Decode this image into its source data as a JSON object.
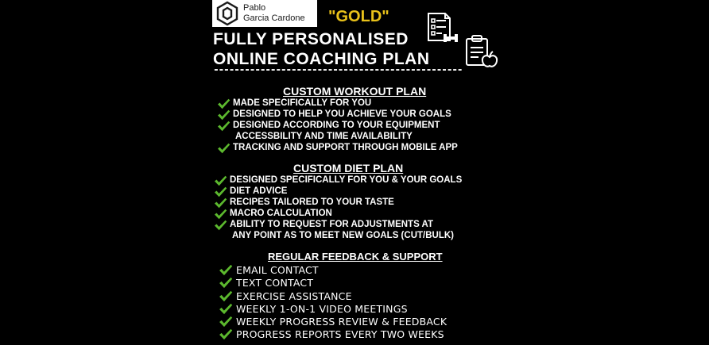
{
  "brand": {
    "logo_line1": "Pablo",
    "logo_line2": "Garcia Cardone",
    "badge": "\"GOLD\""
  },
  "header": {
    "title_line1": "FULLY PERSONALISED",
    "title_line2": "ONLINE COACHING PLAN",
    "divider": "------------------------------------------------",
    "icons": [
      "checklist-dumbbell-icon",
      "clipboard-apple-icon"
    ]
  },
  "workout": {
    "title": "CUSTOM WORKOUT PLAN",
    "items": [
      {
        "lines": [
          "MADE SPECIFICALLY FOR YOU"
        ]
      },
      {
        "lines": [
          "DESIGNED TO HELP YOU ACHIEVE YOUR GOALS"
        ]
      },
      {
        "lines": [
          "DESIGNED ACCORDING TO YOUR EQUIPMENT",
          "ACCESSBILITY AND TIME AVAILABILITY"
        ]
      },
      {
        "lines": [
          "TRACKING AND SUPPORT THROUGH MOBILE APP"
        ]
      }
    ]
  },
  "diet": {
    "title": "CUSTOM DIET PLAN",
    "items": [
      {
        "lines": [
          "DESIGNED SPECIFICALLY FOR YOU & YOUR GOALS"
        ]
      },
      {
        "lines": [
          "DIET ADVICE"
        ]
      },
      {
        "lines": [
          "RECIPES TAILORED TO YOUR TASTE"
        ]
      },
      {
        "lines": [
          "MACRO CALCULATION"
        ]
      },
      {
        "lines": [
          "ABILITY TO REQUEST FOR ADJUSTMENTS AT",
          "ANY POINT AS TO MEET NEW GOALS (CUT/BULK)"
        ]
      }
    ]
  },
  "support": {
    "title": "REGULAR FEEDBACK & SUPPORT",
    "items": [
      {
        "lines": [
          "EMAIL CONTACT"
        ]
      },
      {
        "lines": [
          "TEXT CONTACT"
        ]
      },
      {
        "lines": [
          "EXERCISE ASSISTANCE"
        ]
      },
      {
        "lines": [
          "WEEKLY 1-ON-1 VIDEO MEETINGS"
        ]
      },
      {
        "lines": [
          "WEEKLY PROGRESS REVIEW & FEEDBACK"
        ]
      },
      {
        "lines": [
          "PROGRESS REPORTS EVERY TWO WEEKS"
        ]
      }
    ]
  },
  "colors": {
    "background": "#000000",
    "text": "#ffffff",
    "gold": "#e8c11a",
    "check": "#5cb82e"
  }
}
